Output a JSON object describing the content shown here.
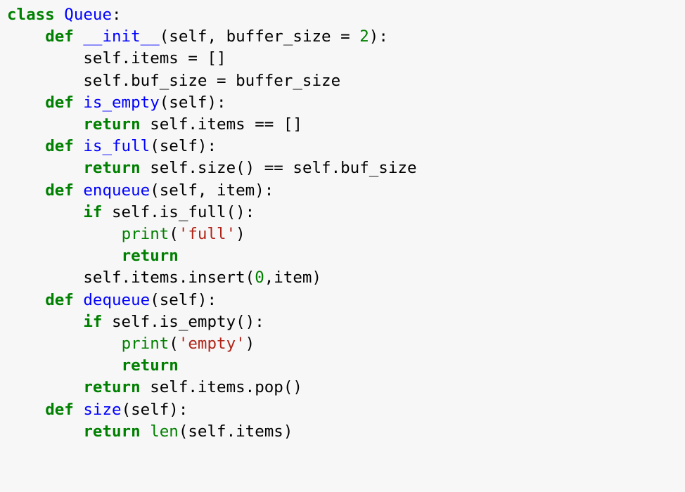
{
  "code": {
    "kw_class": "class",
    "class_name": "Queue",
    "kw_def": "def",
    "kw_return": "return",
    "kw_if": "if",
    "fn_init": "__init__",
    "fn_is_empty": "is_empty",
    "fn_is_full": "is_full",
    "fn_enqueue": "enqueue",
    "fn_dequeue": "dequeue",
    "fn_size": "size",
    "param_self": "self",
    "param_buffer_size": "buffer_size",
    "param_item": "item",
    "num_2": "2",
    "num_0": "0",
    "str_full": "'full'",
    "str_empty": "'empty'",
    "call_print": "print",
    "call_len": "len",
    "line2_body": "(self, buffer_size = ",
    "line2_tail": "):",
    "line3": "        self.items = []",
    "line4": "        self.buf_size = buffer_size",
    "line5_tail": "(self):",
    "line6_body": " self.items == []",
    "line8_body": " self.size() == self.buf_size",
    "line9_body": "(self, item):",
    "line10_body": " self.is_full():",
    "line13": "        self.items.insert(",
    "line13_tail": ",item)",
    "line15_body": " self.is_empty():",
    "line18_body": " self.items.pop()",
    "line20_body": "(self.items)"
  }
}
